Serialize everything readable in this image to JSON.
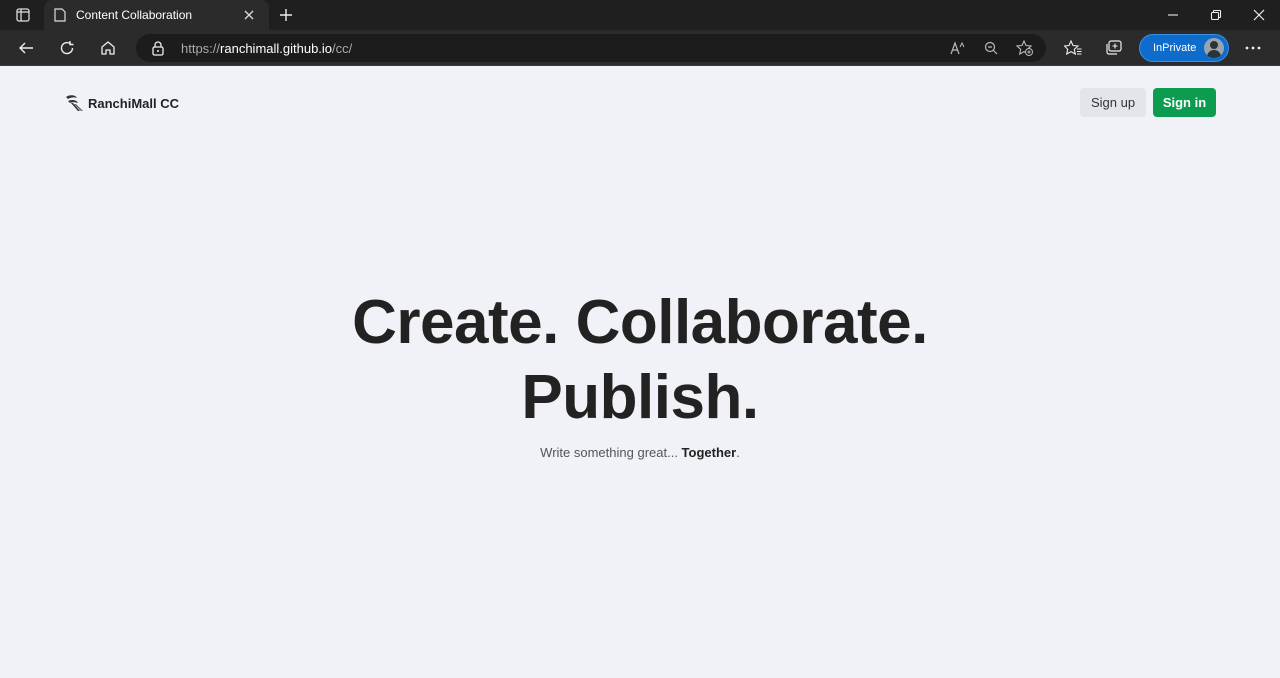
{
  "browser": {
    "tab_title": "Content Collaboration",
    "url_prefix": "https://",
    "url_host": "ranchimall.github.io",
    "url_path": "/cc/",
    "inprivate_label": "InPrivate"
  },
  "site": {
    "brand": "RanchiMall CC",
    "signup_label": "Sign up",
    "signin_label": "Sign in",
    "hero_line1": "Create. Collaborate.",
    "hero_line2": "Publish.",
    "tagline_prefix": "Write something great... ",
    "tagline_emph": "Together",
    "tagline_suffix": "."
  },
  "colors": {
    "accent_green": "#0b9c4f",
    "inprivate_blue": "#0e6ccd",
    "page_bg": "#f0f2f7"
  }
}
